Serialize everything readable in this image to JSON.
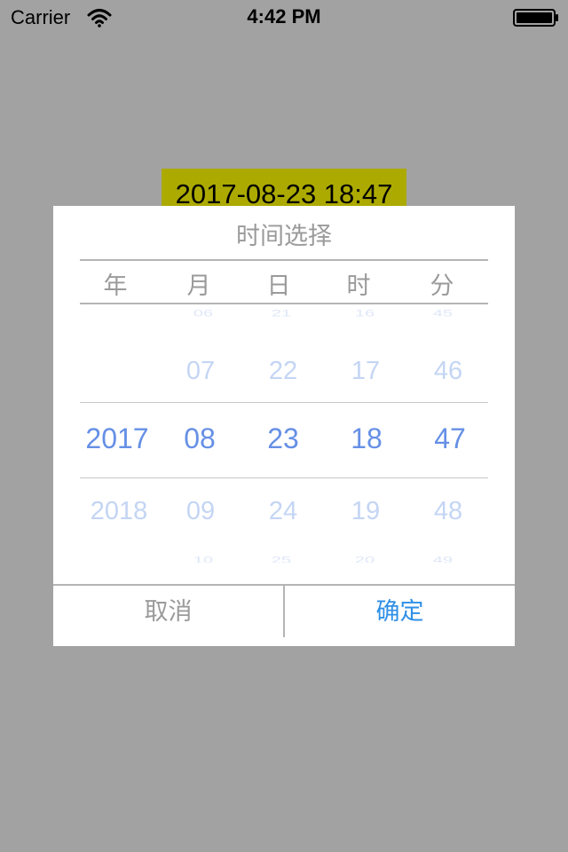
{
  "status_bar": {
    "carrier": "Carrier",
    "time": "4:42 PM",
    "icons": [
      "wifi-icon",
      "battery-icon"
    ]
  },
  "date_label": "2017-08-23 18:47",
  "dialog": {
    "title": "时间选择",
    "headers": [
      "年",
      "月",
      "日",
      "时",
      "分"
    ],
    "columns": [
      {
        "far_prev": "",
        "prev": "",
        "selected": "2017",
        "next": "2018",
        "far_next": ""
      },
      {
        "far_prev": "06",
        "prev": "07",
        "selected": "08",
        "next": "09",
        "far_next": "10"
      },
      {
        "far_prev": "21",
        "prev": "22",
        "selected": "23",
        "next": "24",
        "far_next": "25"
      },
      {
        "far_prev": "16",
        "prev": "17",
        "selected": "18",
        "next": "19",
        "far_next": "20"
      },
      {
        "far_prev": "45",
        "prev": "46",
        "selected": "47",
        "next": "48",
        "far_next": "49"
      }
    ],
    "cancel_label": "取消",
    "confirm_label": "确定"
  },
  "colors": {
    "background": "#a2a2a2",
    "date_label_bg": "#acaa00",
    "selected_value": "#6690e6",
    "confirm": "#2f8fe6",
    "muted_text": "#9a9a9a"
  }
}
